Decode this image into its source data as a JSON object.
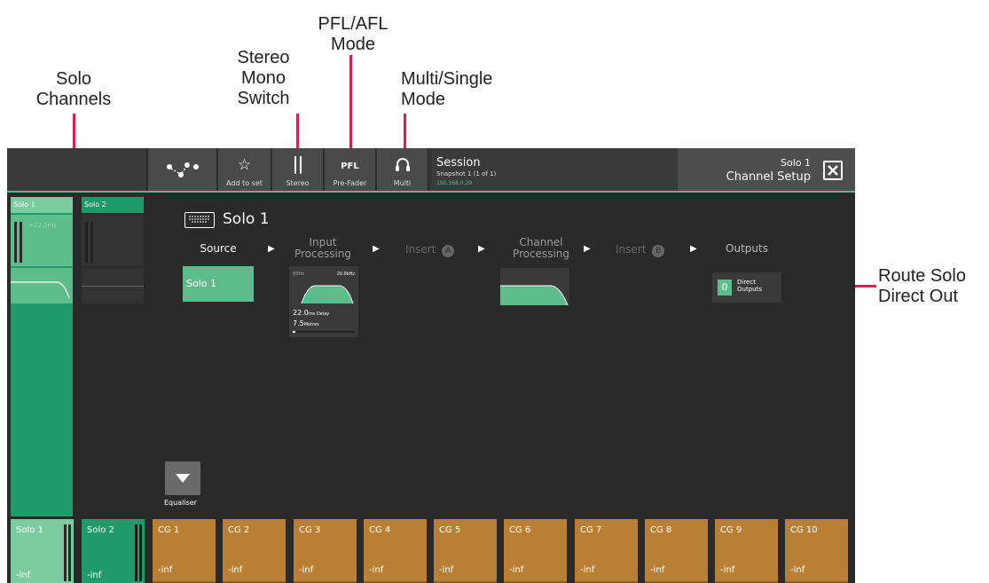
{
  "callouts": {
    "solo_channels": "Solo\nChannels",
    "stereo_mono": "Stereo\nMono\nSwitch",
    "pfl_afl": "PFL/AFL\nMode",
    "multi_single": "Multi/Single\nMode",
    "route_solo": "Route Solo\nDirect Out"
  },
  "toolbar": {
    "routing_icon": "routing-icon",
    "add_to_set_label": "Add to set",
    "stereo_label": "Stereo",
    "pfl_text": "PFL",
    "pre_fader_label": "Pre-Fader",
    "multi_label": "Multi"
  },
  "session": {
    "title": "Session",
    "snapshot": "Snapshot 1 (1 of 1)",
    "ip": "192.168.0.29"
  },
  "channel_setup": {
    "channel": "Solo 1",
    "title": "Channel Setup"
  },
  "strips": {
    "solo1_label": "Solo 1",
    "solo1_delay": "+22.0ms",
    "solo2_label": "Solo 2"
  },
  "main": {
    "channel_name": "Solo 1",
    "source_label": "Source",
    "input_processing_label": "Input\nProcessing",
    "insert_a_label": "Insert",
    "insert_a_badge": "A",
    "channel_processing_label": "Channel\nProcessing",
    "insert_b_label": "Insert",
    "insert_b_badge": "B",
    "outputs_label": "Outputs",
    "source_value": "Solo 1",
    "hpf_value": "83Hz",
    "lpf_value": "20.0kHz",
    "delay_value": "22.0",
    "delay_unit": "ms Delay",
    "distance_value": "7.5",
    "distance_unit": "Metres",
    "direct_count": "0",
    "direct_label": "Direct\nOutputs",
    "equaliser_label": "Equaliser"
  },
  "faders": {
    "solo1": {
      "name": "Solo 1",
      "value": "-inf"
    },
    "solo2": {
      "name": "Solo 2",
      "value": "-inf"
    },
    "cgs": [
      {
        "name": "CG 1",
        "value": "-inf"
      },
      {
        "name": "CG 2",
        "value": "-inf"
      },
      {
        "name": "CG 3",
        "value": "-inf"
      },
      {
        "name": "CG 4",
        "value": "-inf"
      },
      {
        "name": "CG 5",
        "value": "-inf"
      },
      {
        "name": "CG 6",
        "value": "-inf"
      },
      {
        "name": "CG 7",
        "value": "-inf"
      },
      {
        "name": "CG 8",
        "value": "-inf"
      },
      {
        "name": "CG 9",
        "value": "-inf"
      },
      {
        "name": "CG 10",
        "value": "-inf"
      }
    ]
  },
  "colors": {
    "accent_green": "#58b98a",
    "control_group": "#b98035",
    "callout_line": "#d0234f"
  }
}
